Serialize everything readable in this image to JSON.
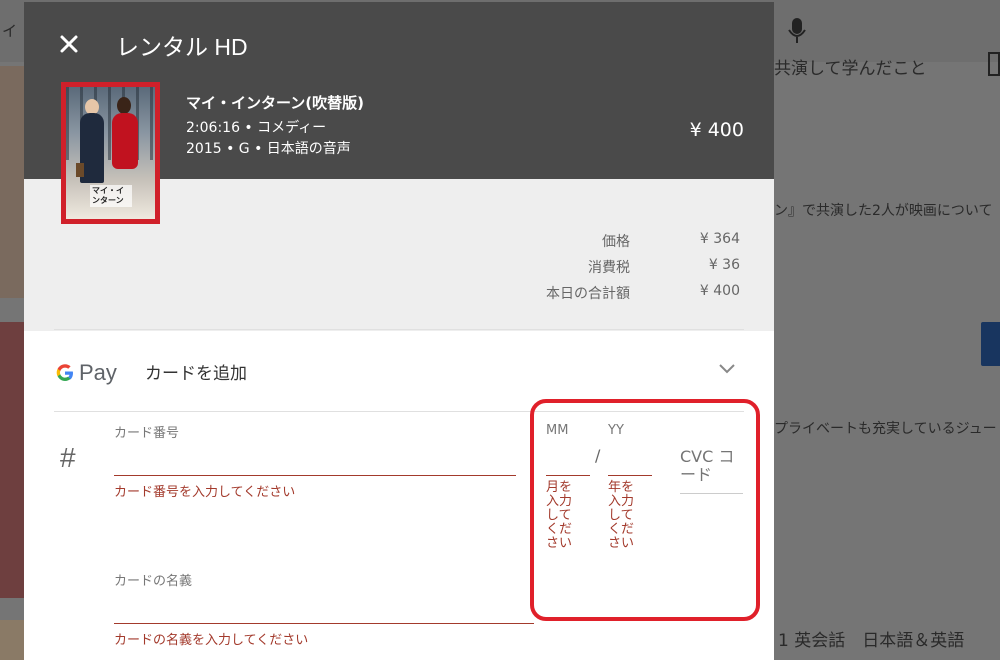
{
  "background": {
    "top_left_text": "イ",
    "right_texts": [
      "共演して学んだこと",
      "ン』で共演した2人が映画について",
      "プライベートも充実しているジュー",
      "1 英会話　日本語＆英語"
    ]
  },
  "dialog": {
    "title": "レンタル HD",
    "movie": {
      "poster_title": "マイ・インターン",
      "name": "マイ・インターン(吹替版)",
      "meta_line1": "2:06:16 • コメディー",
      "meta_line2": "2015 • G • 日本語の音声",
      "price": "¥ 400"
    },
    "summary": [
      {
        "label": "価格",
        "value": "¥ 364"
      },
      {
        "label": "消費税",
        "value": "¥ 36"
      },
      {
        "label": "本日の合計額",
        "value": "¥ 400"
      }
    ],
    "payment": {
      "gpay_text": "Pay",
      "add_card": "カードを追加"
    },
    "form": {
      "card_number_label": "カード番号",
      "card_number_error": "カード番号を入力してください",
      "mm_label": "MM",
      "yy_label": "YY",
      "slash": "/",
      "mm_error": "月を入力してください",
      "yy_error": "年を入力してください",
      "cvc_placeholder": "CVC コード",
      "card_name_label": "カードの名義",
      "card_name_error": "カードの名義を入力してください"
    }
  },
  "colors": {
    "header_bg": "#4a4a4a",
    "summary_bg": "#eeeeee",
    "error": "#a33a2c",
    "highlight": "#e0202a"
  }
}
